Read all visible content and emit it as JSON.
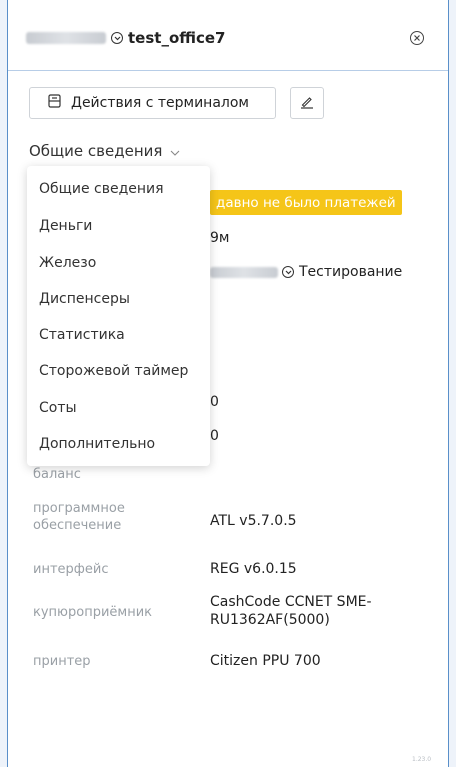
{
  "header": {
    "title": "test_office7"
  },
  "toolbar": {
    "actions_label": "Действия с терминалом",
    "edit_icon": "pencil-icon",
    "actions_icon": "terminal-icon"
  },
  "section_select": {
    "selected": "Общие сведения"
  },
  "dropdown": {
    "items": [
      "Общие сведения",
      "Деньги",
      "Железо",
      "Диспенсеры",
      "Статистика",
      "Сторожевой таймер",
      "Соты",
      "Дополнительно"
    ]
  },
  "info": {
    "status_badge": "давно не было платежей",
    "time_value": "9м",
    "group_value": "Тестирование",
    "value_1": "0",
    "value_2": "0",
    "balance_label": "баланс",
    "software_label": "программное обеспечение",
    "software_value": "ATL v5.7.0.5",
    "interface_label": "интерфейс",
    "interface_value": "REG v6.0.15",
    "validator_label": "купюроприёмник",
    "validator_value": "CashCode CCNET SME-RU1362AF(5000)",
    "printer_label": "принтер",
    "printer_value": "Citizen PPU 700"
  },
  "footer": {
    "version": "1.23.0"
  },
  "colors": {
    "badge_bg": "#f5c518",
    "frame_border": "#5a8fc9"
  }
}
